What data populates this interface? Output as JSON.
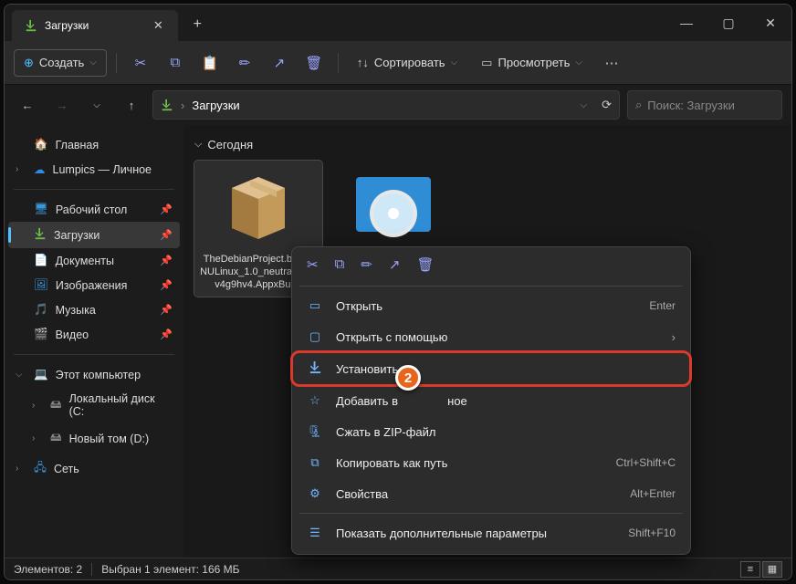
{
  "titlebar": {
    "tab_title": "Загрузки"
  },
  "toolbar": {
    "create": "Создать",
    "sort": "Сортировать",
    "view": "Просмотреть"
  },
  "address": {
    "crumb": "Загрузки",
    "search_placeholder": "Поиск: Загрузки"
  },
  "sidebar": {
    "home": "Главная",
    "onedrive": "Lumpics — Личное",
    "desktop": "Рабочий стол",
    "downloads": "Загрузки",
    "documents": "Документы",
    "pictures": "Изображения",
    "music": "Музыка",
    "videos": "Видео",
    "this_pc": "Этот компьютер",
    "drive_c": "Локальный диск (C:",
    "drive_d": "Новый том (D:)",
    "network": "Сеть"
  },
  "content": {
    "group": "Сегодня",
    "file1": "TheDebianProject.bianGNULinux_1.0_neutral__76v4g9hv4.AppxBund"
  },
  "context": {
    "open": "Открыть",
    "open_sc": "Enter",
    "open_with": "Открыть с помощью",
    "install": "Установить",
    "fav": "Добавить в               ное",
    "zip": "Сжать в ZIP-файл",
    "copy_path": "Копировать как путь",
    "copy_path_sc": "Ctrl+Shift+C",
    "props": "Свойства",
    "props_sc": "Alt+Enter",
    "more": "Показать дополнительные параметры",
    "more_sc": "Shift+F10"
  },
  "status": {
    "count": "Элементов: 2",
    "sel": "Выбран 1 элемент: 166 МБ"
  },
  "annotation": "2"
}
